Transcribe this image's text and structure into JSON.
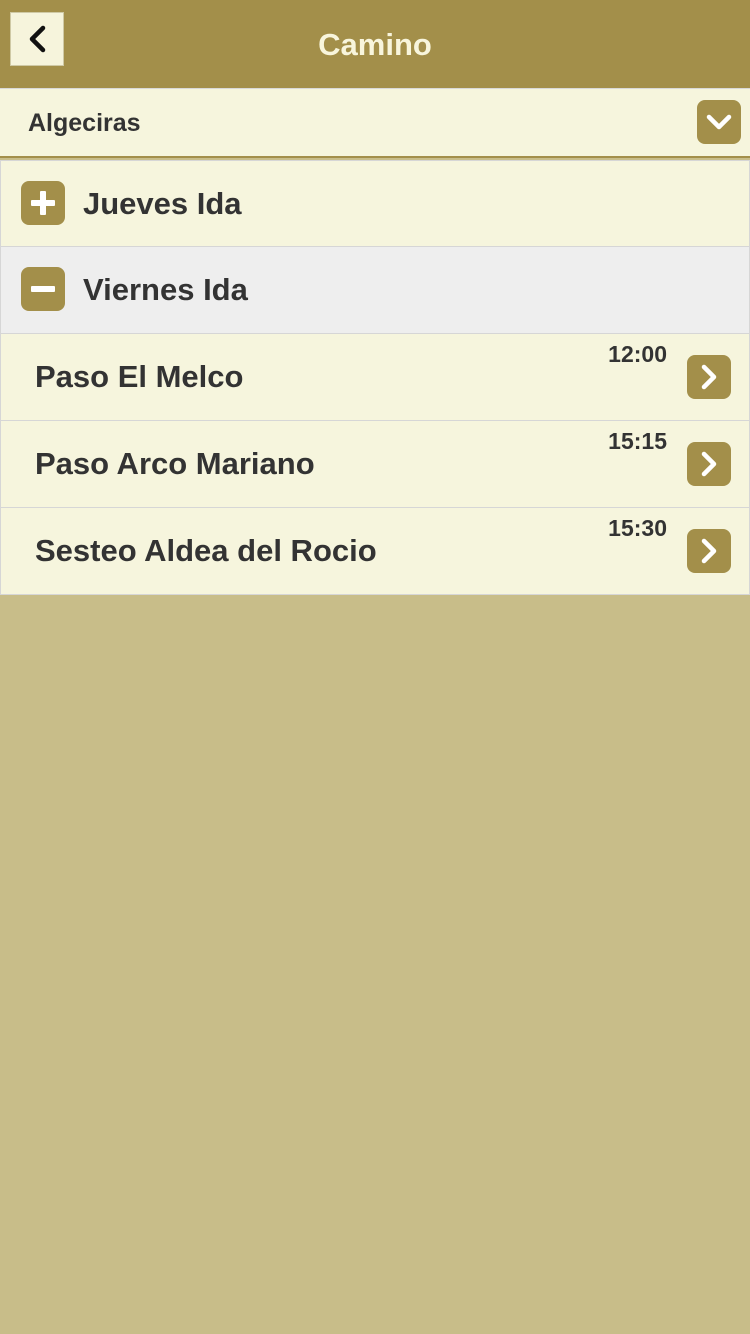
{
  "header": {
    "title": "Camino",
    "back_icon": "chevron-left-icon"
  },
  "selector": {
    "value": "Algeciras",
    "icon": "chevron-down-icon"
  },
  "groups": [
    {
      "label": "Jueves Ida",
      "expanded": false,
      "icon": "plus-icon",
      "items": []
    },
    {
      "label": "Viernes Ida",
      "expanded": true,
      "icon": "minus-icon",
      "items": [
        {
          "label": "Paso El Melco",
          "time": "12:00",
          "icon": "chevron-right-icon"
        },
        {
          "label": "Paso Arco Mariano",
          "time": "15:15",
          "icon": "chevron-right-icon"
        },
        {
          "label": "Sesteo Aldea del Rocio",
          "time": "15:30",
          "icon": "chevron-right-icon"
        }
      ]
    }
  ],
  "colors": {
    "accent": "#a38f4a",
    "row_background": "#f6f5dd",
    "expanded_background": "#eeeeee",
    "page_background": "#c8bd89",
    "text": "#333333"
  }
}
